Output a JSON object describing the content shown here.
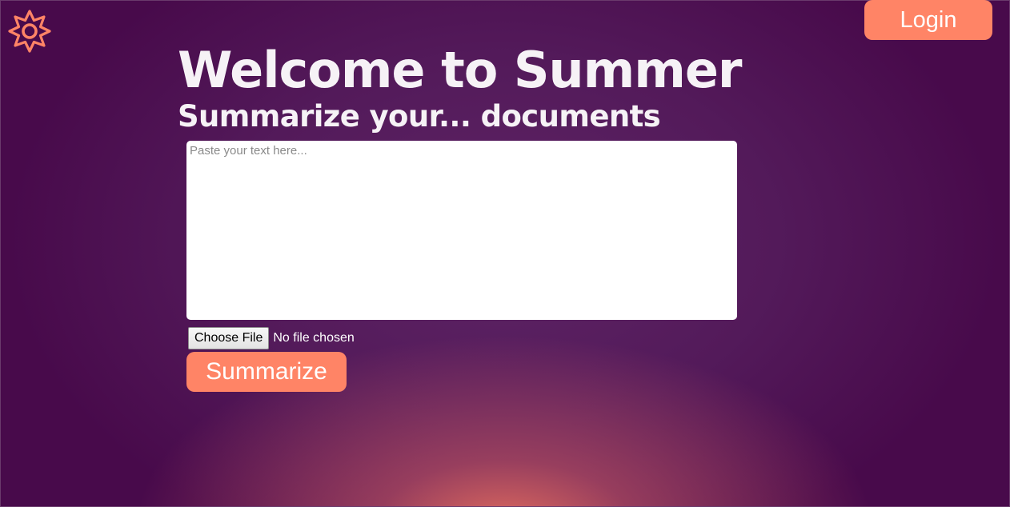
{
  "app": {
    "logo_icon": "sun-gear-icon",
    "accent_color": "#ff8466"
  },
  "header": {
    "login_label": "Login"
  },
  "main": {
    "title": "Welcome to Summer",
    "subtitle": "Summarize your... documents",
    "text_input": {
      "placeholder": "Paste your text here...",
      "value": ""
    },
    "file_input": {
      "button_label": "Choose File",
      "status": "No file chosen"
    },
    "summarize_label": "Summarize"
  }
}
